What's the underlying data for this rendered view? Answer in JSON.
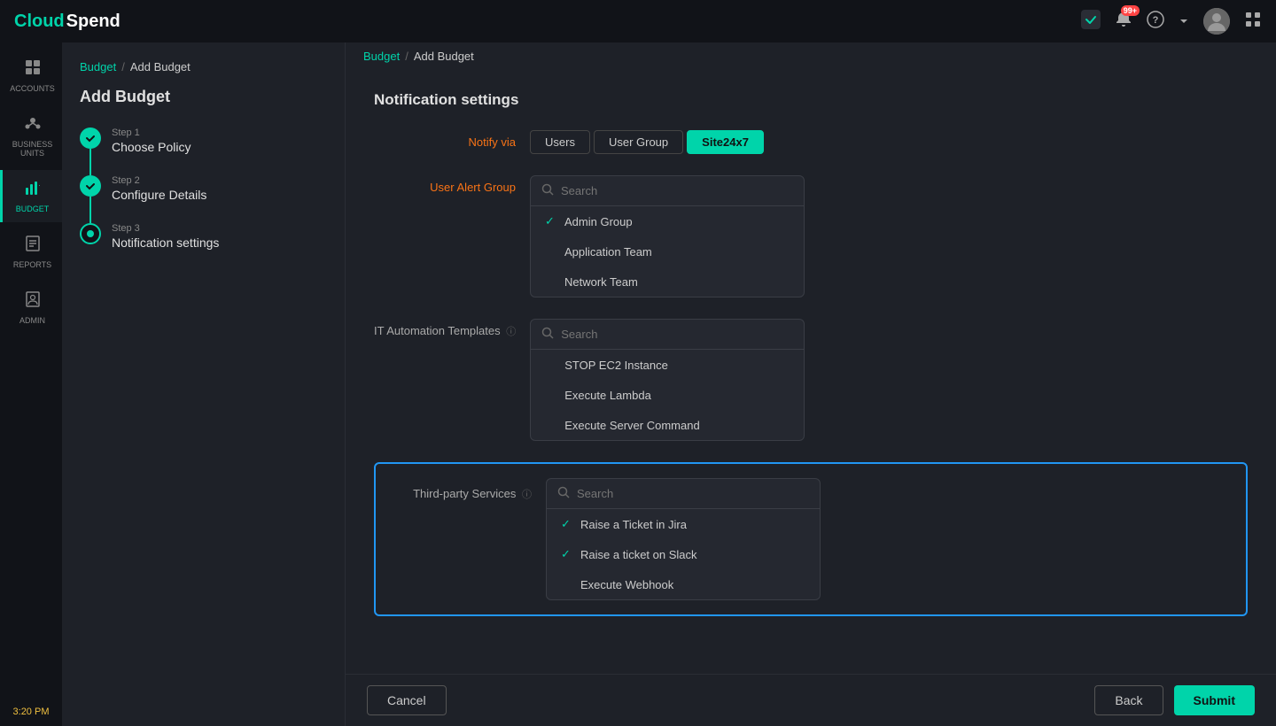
{
  "app": {
    "logo_cloud": "Cloud",
    "logo_spend": "Spend",
    "time": "3:20 PM"
  },
  "topnav": {
    "notification_badge": "99+",
    "help_label": "?"
  },
  "breadcrumb": {
    "parent": "Budget",
    "separator": "/",
    "current": "Add Budget"
  },
  "sidebar": {
    "items": [
      {
        "id": "accounts",
        "label": "ACCOUNTS",
        "icon": "⊞"
      },
      {
        "id": "business-units",
        "label": "BUSINESS UNITS",
        "icon": "✦"
      },
      {
        "id": "budget",
        "label": "BUDGET",
        "icon": "📊",
        "active": true
      },
      {
        "id": "reports",
        "label": "REPORTS",
        "icon": "📋"
      },
      {
        "id": "admin",
        "label": "ADMIN",
        "icon": "👤"
      }
    ]
  },
  "left_panel": {
    "title": "Add Budget",
    "steps": [
      {
        "id": "step1",
        "label": "Step 1",
        "name": "Choose Policy",
        "state": "done"
      },
      {
        "id": "step2",
        "label": "Step 2",
        "name": "Configure Details",
        "state": "done"
      },
      {
        "id": "step3",
        "label": "Step 3",
        "name": "Notification settings",
        "state": "active"
      }
    ]
  },
  "main": {
    "title": "Notification settings",
    "notify_via_label": "Notify via",
    "notify_tabs": [
      {
        "id": "users",
        "label": "Users"
      },
      {
        "id": "user-group",
        "label": "User Group"
      },
      {
        "id": "site24x7",
        "label": "Site24x7",
        "active": true
      }
    ],
    "user_alert_group": {
      "label": "User Alert Group",
      "search_placeholder": "Search",
      "items": [
        {
          "label": "Admin Group",
          "checked": true
        },
        {
          "label": "Application Team",
          "checked": false
        },
        {
          "label": "Network Team",
          "checked": false
        }
      ]
    },
    "it_automation": {
      "label": "IT Automation Templates",
      "search_placeholder": "Search",
      "items": [
        {
          "label": "STOP EC2 Instance",
          "checked": false
        },
        {
          "label": "Execute Lambda",
          "checked": false
        },
        {
          "label": "Execute Server Command",
          "checked": false
        }
      ]
    },
    "third_party": {
      "label": "Third-party Services",
      "search_placeholder": "Search",
      "items": [
        {
          "label": "Raise a Ticket in Jira",
          "checked": true
        },
        {
          "label": "Raise a ticket on Slack",
          "checked": true
        },
        {
          "label": "Execute Webhook",
          "checked": false
        }
      ]
    }
  },
  "footer": {
    "cancel_label": "Cancel",
    "back_label": "Back",
    "submit_label": "Submit"
  }
}
